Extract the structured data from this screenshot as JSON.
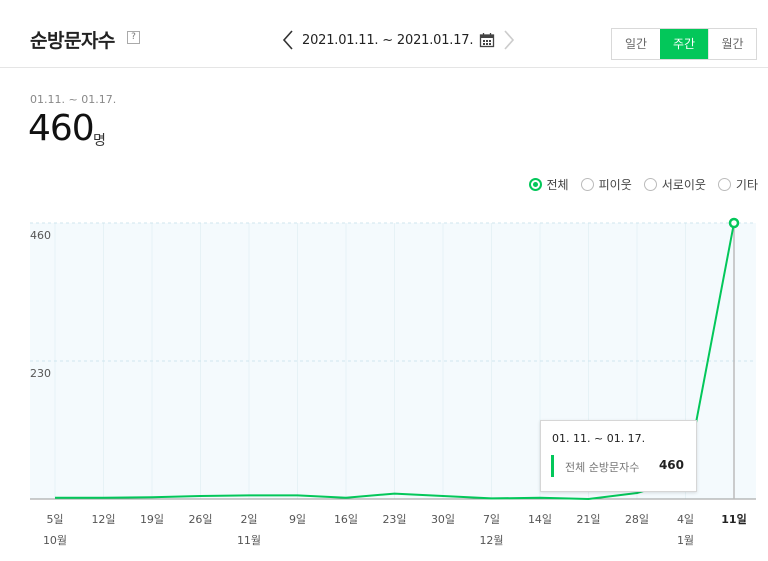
{
  "header": {
    "title": "순방문자수",
    "help_icon": "?",
    "date_range": "2021.01.11. ~ 2021.01.17.",
    "prev_icon": "chevron-left-icon",
    "next_icon": "chevron-right-icon",
    "calendar_icon": "calendar-icon",
    "period_buttons": [
      {
        "label": "일간",
        "active": false
      },
      {
        "label": "주간",
        "active": true
      },
      {
        "label": "월간",
        "active": false
      }
    ]
  },
  "summary": {
    "range": "01.11. ~ 01.17.",
    "value": "460",
    "unit": "명"
  },
  "filters": [
    {
      "label": "전체",
      "selected": true
    },
    {
      "label": "피이웃",
      "selected": false
    },
    {
      "label": "서로이웃",
      "selected": false
    },
    {
      "label": "기타",
      "selected": false
    }
  ],
  "tooltip": {
    "range": "01. 11. ~ 01. 17.",
    "label": "전체 순방문자수",
    "value": "460"
  },
  "colors": {
    "accent": "#03c75a",
    "plot_bg": "#f4fafd",
    "grid": "#cfe6ee"
  },
  "chart_data": {
    "type": "line",
    "x": [
      "5일",
      "12일",
      "19일",
      "26일",
      "2일",
      "9일",
      "16일",
      "23일",
      "30일",
      "7일",
      "14일",
      "21일",
      "28일",
      "4일",
      "11일"
    ],
    "month_labels": [
      {
        "index": 0,
        "label": "10월"
      },
      {
        "index": 4,
        "label": "11월"
      },
      {
        "index": 9,
        "label": "12월"
      },
      {
        "index": 13,
        "label": "1월"
      }
    ],
    "series": [
      {
        "values": [
          2,
          2,
          3,
          5,
          6,
          6,
          2,
          9,
          5,
          1,
          2,
          0,
          10,
          35,
          460
        ]
      }
    ],
    "y_ticks": [
      230,
      460
    ],
    "ylim": [
      0,
      460
    ],
    "highlight_index": 14,
    "grid": true
  }
}
